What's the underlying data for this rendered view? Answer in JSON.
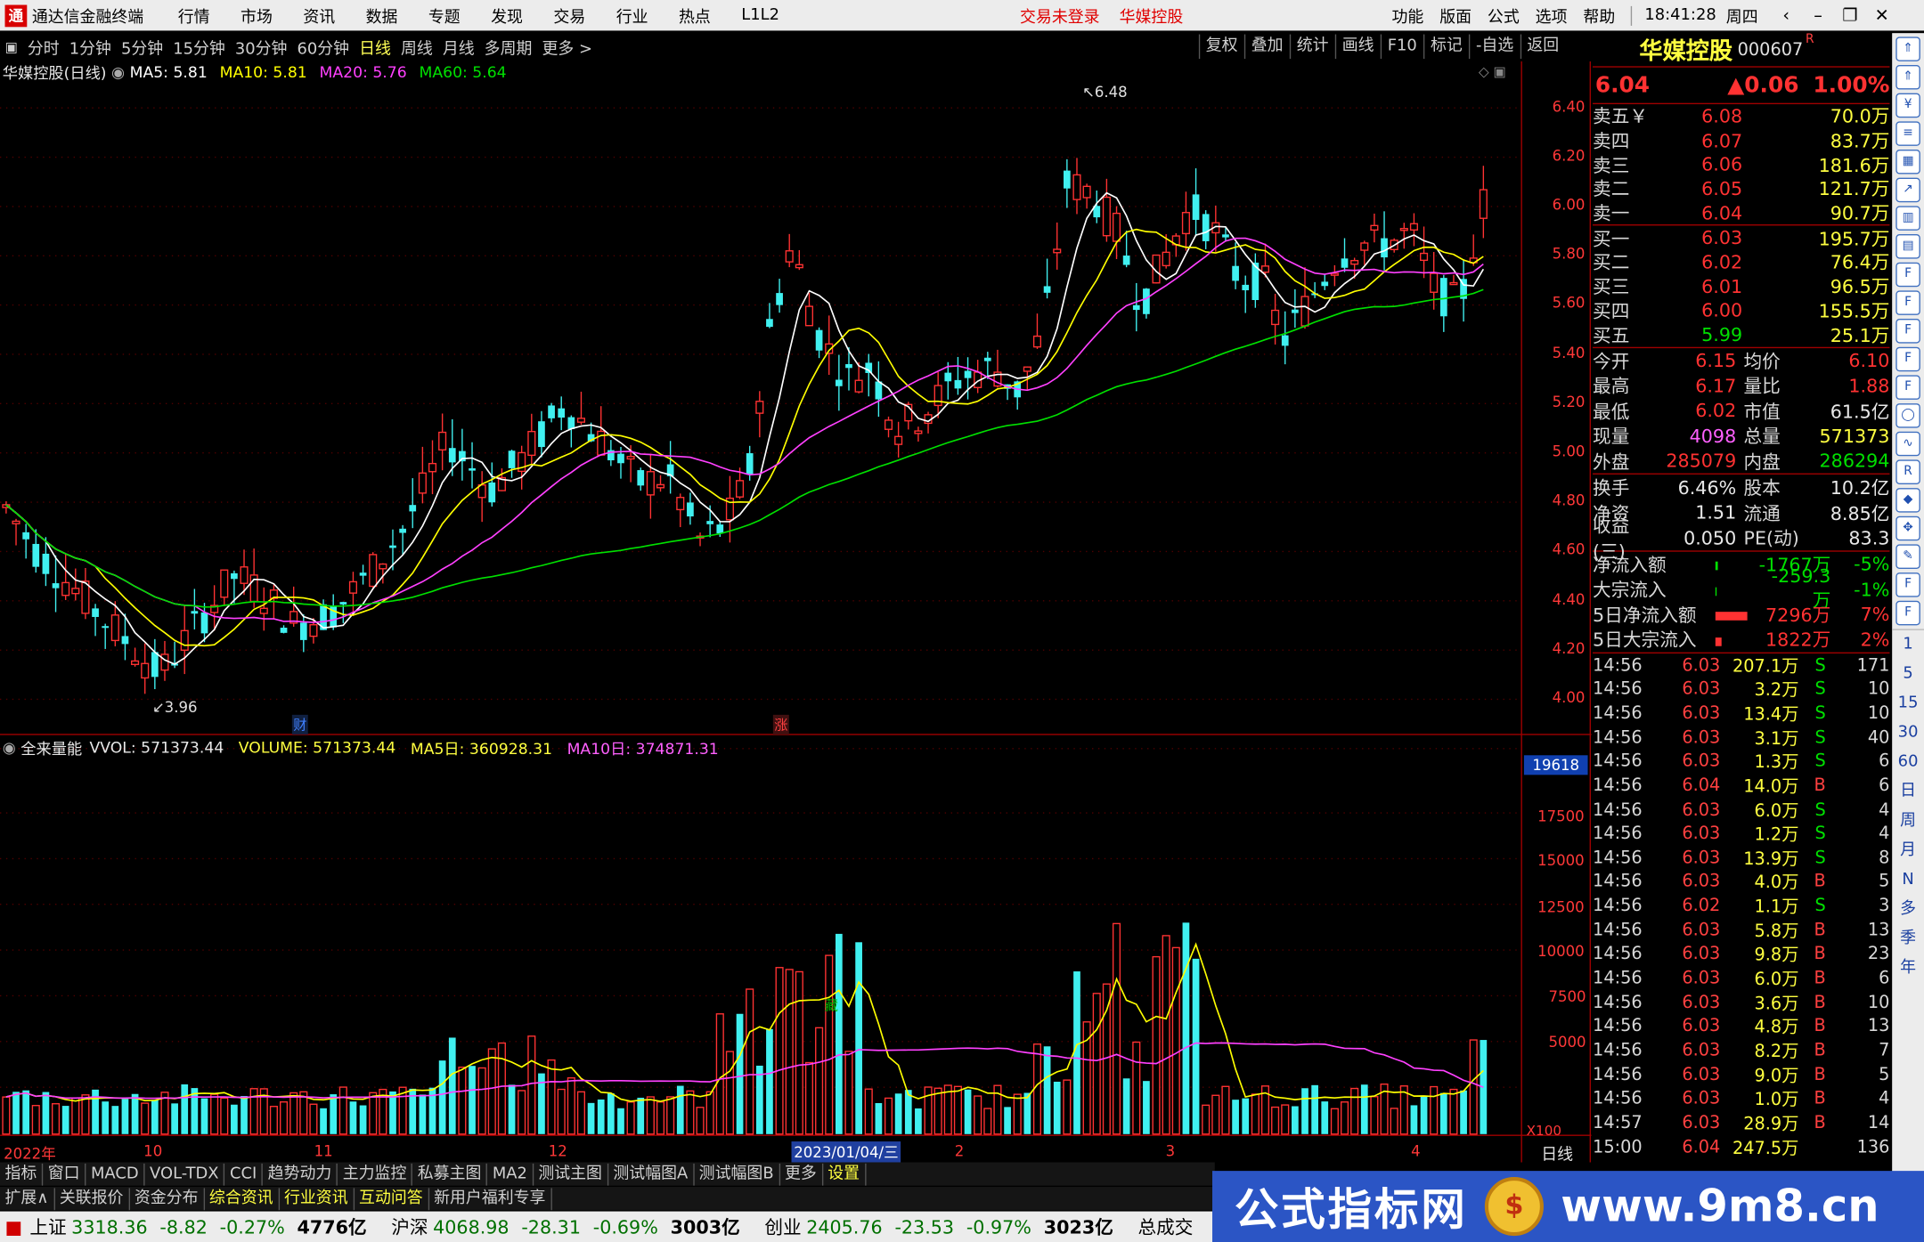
{
  "app": {
    "title": "通达信金融终端",
    "menu": [
      "行情",
      "市场",
      "资讯",
      "数据",
      "专题",
      "发现",
      "交易",
      "行业",
      "热点",
      "L1L2"
    ],
    "trade_status": "交易未登录",
    "stock_short": "华媒控股",
    "right_menu": [
      "功能",
      "版面",
      "公式",
      "选项",
      "帮助"
    ],
    "clock": "18:41:28",
    "weekday": "周四"
  },
  "periods": [
    "分时",
    "1分钟",
    "5分钟",
    "15分钟",
    "30分钟",
    "60分钟",
    "日线",
    "周线",
    "月线",
    "多周期",
    "更多 >"
  ],
  "active_period": "日线",
  "toolbar": [
    "复权",
    "叠加",
    "统计",
    "画线",
    "F10",
    "标记",
    "-自选",
    "返回"
  ],
  "main_chart": {
    "name": "华媒控股(日线)",
    "ma": [
      {
        "label": "MA5: 5.81",
        "color": "#ffffff"
      },
      {
        "label": "MA10: 5.81",
        "color": "#ffff00"
      },
      {
        "label": "MA20: 5.76",
        "color": "#ff40ff"
      },
      {
        "label": "MA60: 5.64",
        "color": "#00e000"
      }
    ],
    "price_ticks": [
      "6.40",
      "6.20",
      "6.00",
      "5.80",
      "5.60",
      "5.40",
      "5.20",
      "5.00",
      "4.80",
      "4.60",
      "4.40",
      "4.20",
      "4.00"
    ],
    "high_mark": "6.48",
    "low_mark": "3.96",
    "event_cai": "财",
    "event_zhang": "涨"
  },
  "volume_chart": {
    "name": "全来量能",
    "vvol": "VVOL: 571373.44",
    "volume": "VOLUME: 571373.44",
    "ma5": "MA5日: 360928.31",
    "ma10": "MA10日: 374871.31",
    "ticks": [
      "17500",
      "15000",
      "12500",
      "10000",
      "7500",
      "5000"
    ],
    "cursor_value": "19618",
    "unit": "X100",
    "mark": "藏"
  },
  "date_axis": {
    "labels": [
      "2022年",
      "10",
      "11",
      "12",
      "3",
      "4"
    ],
    "cursor_date": "2023/01/04/三",
    "cursor_label_tail": "2",
    "period_label": "日线"
  },
  "quote": {
    "name": "华媒控股",
    "code": "000607",
    "r_mark": "R",
    "price": "6.04",
    "change": "▲0.06",
    "pct": "1.00%",
    "asks": [
      {
        "label": "卖五￥",
        "price": "6.08",
        "vol": "70.0万"
      },
      {
        "label": "卖四",
        "price": "6.07",
        "vol": "83.7万"
      },
      {
        "label": "卖三",
        "price": "6.06",
        "vol": "181.6万"
      },
      {
        "label": "卖二",
        "price": "6.05",
        "vol": "121.7万"
      },
      {
        "label": "卖一",
        "price": "6.04",
        "vol": "90.7万"
      }
    ],
    "bids": [
      {
        "label": "买一",
        "price": "6.03",
        "vol": "195.7万"
      },
      {
        "label": "买二",
        "price": "6.02",
        "vol": "76.4万"
      },
      {
        "label": "买三",
        "price": "6.01",
        "vol": "96.5万"
      },
      {
        "label": "买四",
        "price": "6.00",
        "vol": "155.5万"
      },
      {
        "label": "买五",
        "price": "5.99",
        "vol": "25.1万"
      }
    ],
    "stats1": [
      {
        "a": "今开",
        "b": "6.15",
        "bc": "red",
        "c": "均价",
        "d": "6.10",
        "dc": "red"
      },
      {
        "a": "最高",
        "b": "6.17",
        "bc": "red",
        "c": "量比",
        "d": "1.88",
        "dc": "red"
      },
      {
        "a": "最低",
        "b": "6.02",
        "bc": "red",
        "c": "市值",
        "d": "61.5亿",
        "dc": "wht"
      },
      {
        "a": "现量",
        "b": "4098",
        "bc": "mag",
        "c": "总量",
        "d": "571373",
        "dc": "yel"
      },
      {
        "a": "外盘",
        "b": "285079",
        "bc": "red",
        "c": "内盘",
        "d": "286294",
        "dc": "grn"
      }
    ],
    "stats2": [
      {
        "a": "换手",
        "b": "6.46%",
        "bc": "wht",
        "c": "股本",
        "d": "10.2亿",
        "dc": "wht"
      },
      {
        "a": "净资",
        "b": "1.51",
        "bc": "wht",
        "c": "流通",
        "d": "8.85亿",
        "dc": "wht"
      },
      {
        "a": "收益(三)",
        "b": "0.050",
        "bc": "wht",
        "c": "PE(动)",
        "d": "83.3",
        "dc": "wht"
      }
    ],
    "flows": [
      {
        "label": "净流入额",
        "value": "-1767万",
        "pct": "-5%",
        "color": "#00e000",
        "bar": 2
      },
      {
        "label": "大宗流入",
        "value": "-259.3万",
        "pct": "-1%",
        "color": "#00e000",
        "bar": 1
      },
      {
        "label": "5日净流入额",
        "value": "7296万",
        "pct": "7%",
        "color": "#ff3232",
        "bar": 26
      },
      {
        "label": "5日大宗流入",
        "value": "1822万",
        "pct": "2%",
        "color": "#ff3232",
        "bar": 5
      }
    ]
  },
  "ticks": [
    {
      "t": "14:56",
      "p": "6.03",
      "v": "207.1万",
      "s": "S",
      "n": "171"
    },
    {
      "t": "14:56",
      "p": "6.03",
      "v": "3.2万",
      "s": "S",
      "n": "10"
    },
    {
      "t": "14:56",
      "p": "6.03",
      "v": "13.4万",
      "s": "S",
      "n": "10"
    },
    {
      "t": "14:56",
      "p": "6.03",
      "v": "3.1万",
      "s": "S",
      "n": "40"
    },
    {
      "t": "14:56",
      "p": "6.03",
      "v": "1.3万",
      "s": "S",
      "n": "6"
    },
    {
      "t": "14:56",
      "p": "6.04",
      "v": "14.0万",
      "s": "B",
      "n": "6"
    },
    {
      "t": "14:56",
      "p": "6.03",
      "v": "6.0万",
      "s": "S",
      "n": "4"
    },
    {
      "t": "14:56",
      "p": "6.03",
      "v": "1.2万",
      "s": "S",
      "n": "4"
    },
    {
      "t": "14:56",
      "p": "6.03",
      "v": "13.9万",
      "s": "S",
      "n": "8"
    },
    {
      "t": "14:56",
      "p": "6.03",
      "v": "4.0万",
      "s": "B",
      "n": "5"
    },
    {
      "t": "14:56",
      "p": "6.02",
      "v": "1.1万",
      "s": "S",
      "n": "3"
    },
    {
      "t": "14:56",
      "p": "6.03",
      "v": "5.8万",
      "s": "B",
      "n": "13"
    },
    {
      "t": "14:56",
      "p": "6.03",
      "v": "9.8万",
      "s": "B",
      "n": "23"
    },
    {
      "t": "14:56",
      "p": "6.03",
      "v": "6.0万",
      "s": "B",
      "n": "6"
    },
    {
      "t": "14:56",
      "p": "6.03",
      "v": "3.6万",
      "s": "B",
      "n": "10"
    },
    {
      "t": "14:56",
      "p": "6.03",
      "v": "4.8万",
      "s": "B",
      "n": "13"
    },
    {
      "t": "14:56",
      "p": "6.03",
      "v": "8.2万",
      "s": "B",
      "n": "7"
    },
    {
      "t": "14:56",
      "p": "6.03",
      "v": "9.0万",
      "s": "B",
      "n": "5"
    },
    {
      "t": "14:56",
      "p": "6.03",
      "v": "1.0万",
      "s": "B",
      "n": "4"
    },
    {
      "t": "14:57",
      "p": "6.03",
      "v": "28.9万",
      "s": "B",
      "n": "14"
    },
    {
      "t": "15:00",
      "p": "6.04",
      "v": "247.5万",
      "s": "",
      "n": "136"
    }
  ],
  "side_icons": [
    "up-icon",
    "up-icon",
    "fund-icon",
    "list-icon",
    "table-icon",
    "chart-icon",
    "kline-icon",
    "grid-icon",
    "fq-icon",
    "f10-icon",
    "f1-icon",
    "f2-icon",
    "f3-icon",
    "circle-icon",
    "line-icon",
    "rsi-icon",
    "mark-icon",
    "cross-icon",
    "pen-icon",
    "f5-icon",
    "f6-icon"
  ],
  "side_days": [
    "1",
    "5",
    "15",
    "30",
    "60",
    "日",
    "周",
    "月",
    "N",
    "多",
    "季",
    "年"
  ],
  "bottom_tabs1": [
    "指标",
    "窗口",
    "MACD",
    "VOL-TDX",
    "CCI",
    "趋势动力",
    "主力监控",
    "私募主图",
    "MA2",
    "测试主图",
    "测试幅图A",
    "测试幅图B",
    "更多",
    "设置"
  ],
  "bottom_tabs2": [
    "扩展∧",
    "关联报价",
    "资金分布",
    "综合资讯",
    "行业资讯",
    "互动问答",
    "新用户福利专享"
  ],
  "status": [
    {
      "name": "上证",
      "val": "3318.36",
      "chg": "-8.82",
      "pct": "-0.27%",
      "amt": "4776亿"
    },
    {
      "name": "沪深",
      "val": "4068.98",
      "chg": "-28.31",
      "pct": "-0.69%",
      "amt": "3003亿"
    },
    {
      "name": "创业",
      "val": "2405.76",
      "chg": "-23.53",
      "pct": "-0.97%",
      "amt": "3023亿"
    }
  ],
  "status_tail": "总成交",
  "banner": {
    "title": "公式指标网",
    "url": "www.9m8.cn"
  }
}
